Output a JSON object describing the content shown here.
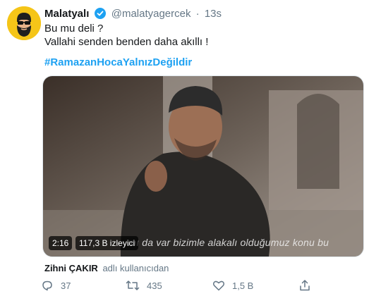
{
  "tweet": {
    "author_name": "Malatyalı",
    "handle": "@malatyagercek",
    "separator": "·",
    "time": "13s",
    "text_lines": [
      "Bu mu deli ?",
      "Vallahi senden benden daha akıllı !"
    ],
    "hashtag": "#RamazanHocaYalnızDeğildir"
  },
  "media": {
    "subtitle": "ını da var bizimle alakalı olduğumuz konu bu",
    "duration": "2:16",
    "views": "117,3 B izleyici"
  },
  "tagged": {
    "name": "Zihni ÇAKIR",
    "suffix": "adlı kullanıcıdan"
  },
  "actions": {
    "reply_count": "37",
    "retweet_count": "435",
    "like_count": "1,5 B",
    "icons": [
      "reply-icon",
      "retweet-icon",
      "like-icon",
      "share-icon"
    ]
  },
  "colors": {
    "accent": "#1da1f2",
    "secondary_text": "#657786",
    "avatar_bg": "#f5c518"
  }
}
